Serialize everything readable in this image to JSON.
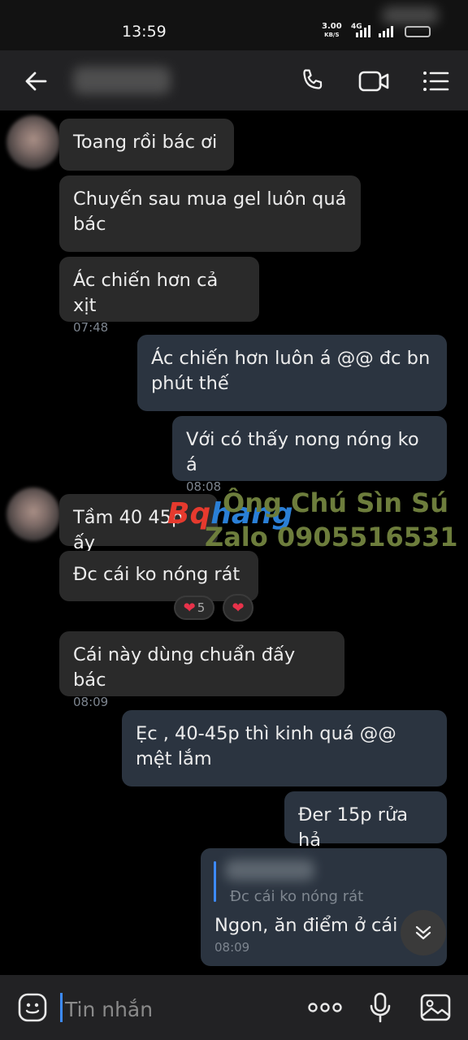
{
  "status_bar": {
    "time": "13:59",
    "speed_value": "3.00",
    "speed_unit": "KB/S",
    "network": "4G"
  },
  "header": {
    "contact_name": ""
  },
  "messages": [
    {
      "dir": "in",
      "text": "Toang rồi bác ơi",
      "time": ""
    },
    {
      "dir": "in",
      "text": "Chuyến sau mua gel luôn quá bác",
      "time": ""
    },
    {
      "dir": "in",
      "text": "Ác chiến hơn cả xịt",
      "time": "07:48"
    },
    {
      "dir": "out",
      "text": "Ác chiến hơn luôn á @@ đc bn phút thế",
      "time": ""
    },
    {
      "dir": "out",
      "text": "Với có thấy nong nóng ko á",
      "time": "08:08"
    },
    {
      "dir": "in",
      "text": "Tầm 40 45p ấy",
      "time": ""
    },
    {
      "dir": "in",
      "text": "Đc cái ko nóng rát",
      "time": "",
      "reaction_count": "5"
    },
    {
      "dir": "in",
      "text": "Cái này dùng chuẩn đấy bác",
      "time": "08:09"
    },
    {
      "dir": "out",
      "text": "Ẹc , 40-45p thì kinh quá @@ mệt lắm",
      "time": ""
    },
    {
      "dir": "out",
      "text": "Đer 15p rửa hả",
      "time": ""
    },
    {
      "dir": "out",
      "text": "Ngon, ăn điểm ở cái",
      "time": "08:09",
      "quoted_text": "Đc cái ko nóng rát"
    }
  ],
  "watermark": {
    "line1": "Ông Chú Sìn Sú",
    "line2": "Zalo 0905516531",
    "logo_a": "Bq",
    "logo_b": "hang"
  },
  "input": {
    "placeholder": "Tin nhắn"
  },
  "colors": {
    "incoming_bubble": "#2a2a2a",
    "outgoing_bubble": "#2b3440",
    "accent": "#3d8bff",
    "heart": "#e8324a"
  }
}
